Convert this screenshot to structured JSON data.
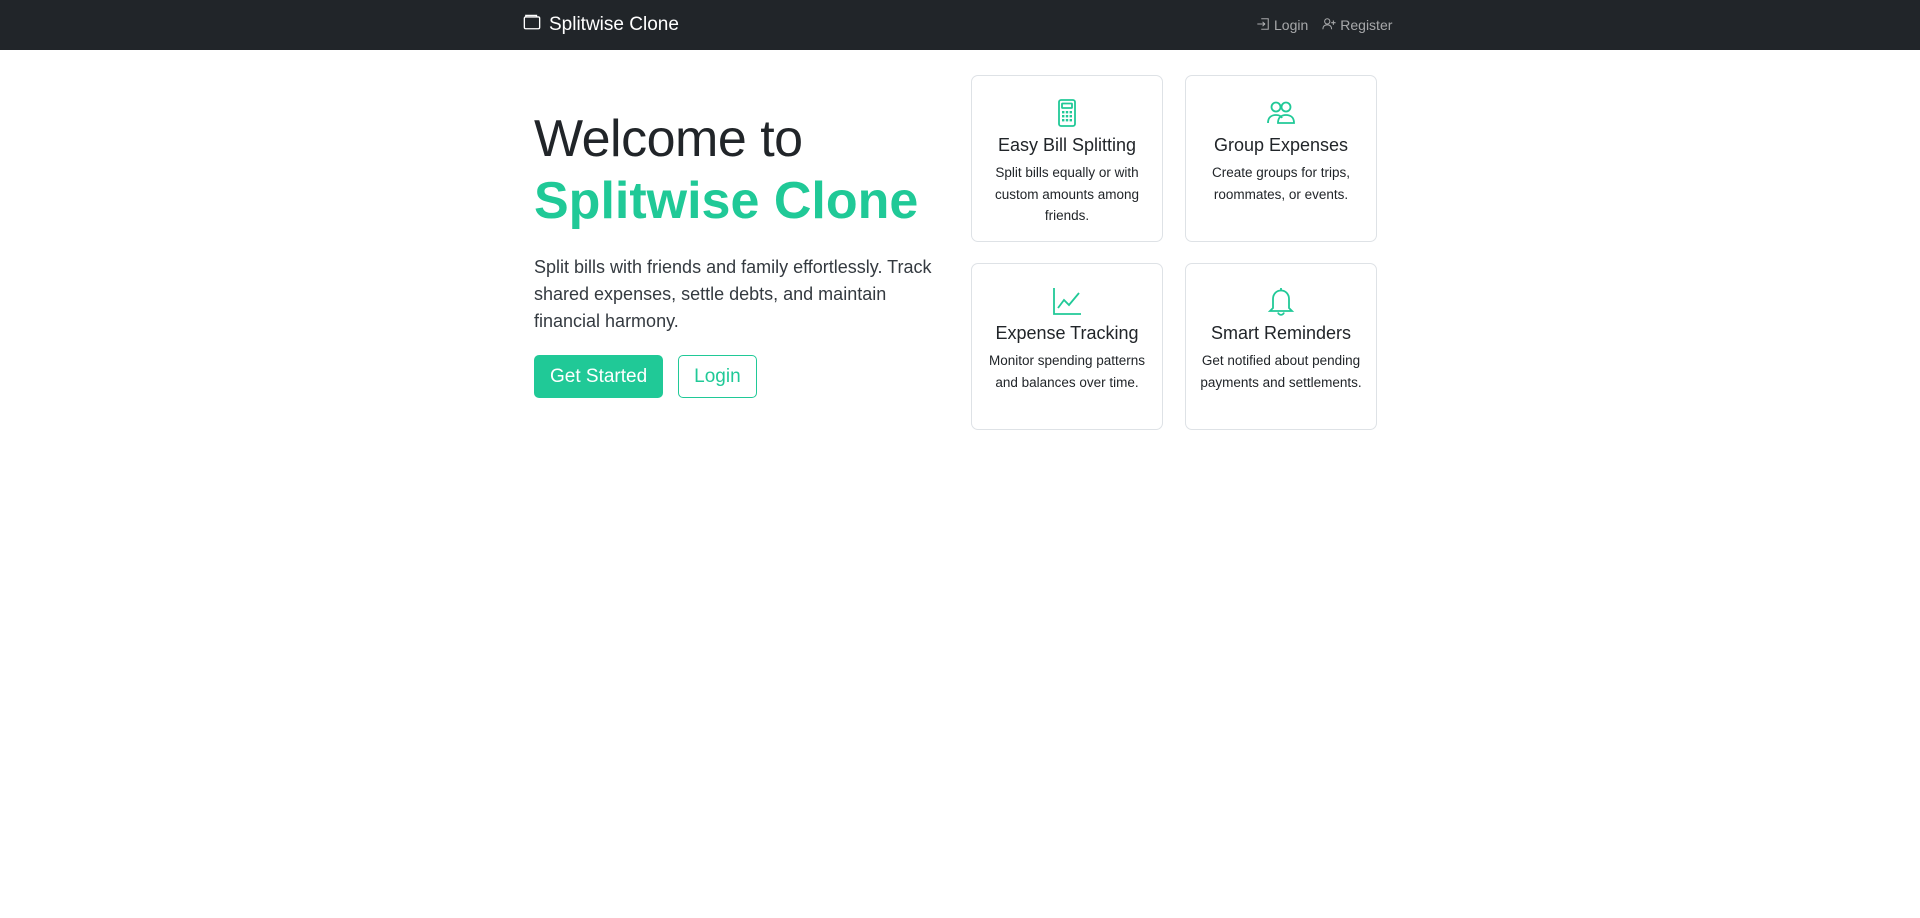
{
  "navbar": {
    "brand": {
      "icon": "wallet-icon",
      "label": "Splitwise Clone"
    },
    "links": [
      {
        "icon": "login-icon",
        "label": "Login"
      },
      {
        "icon": "register-icon",
        "label": "Register"
      }
    ]
  },
  "hero": {
    "title_line1": "Welcome to",
    "title_line2": "Splitwise Clone",
    "lead": "Split bills with friends and family effortlessly. Track shared expenses, settle debts, and maintain financial harmony.",
    "primary_button": "Get Started",
    "secondary_button": "Login"
  },
  "features": [
    {
      "icon": "calculator-icon",
      "title": "Easy Bill Splitting",
      "text": "Split bills equally or with custom amounts among friends."
    },
    {
      "icon": "people-icon",
      "title": "Group Expenses",
      "text": "Create groups for trips, roommates, or events."
    },
    {
      "icon": "graph-icon",
      "title": "Expense Tracking",
      "text": "Monitor spending patterns and balances over time."
    },
    {
      "icon": "bell-icon",
      "title": "Smart Reminders",
      "text": "Get notified about pending payments and settlements."
    }
  ],
  "colors": {
    "accent": "#20c997",
    "navbar_bg": "#212529"
  }
}
